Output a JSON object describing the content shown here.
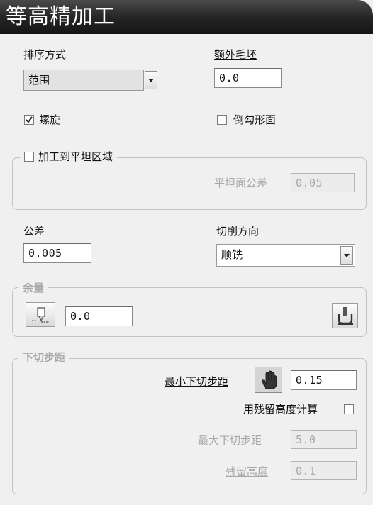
{
  "window": {
    "title": "等高精加工"
  },
  "order": {
    "label": "排序方式",
    "value": "范围"
  },
  "extra_stock": {
    "label": "额外毛坯",
    "value": "0.0"
  },
  "spiral": {
    "label": "螺旋",
    "checked": true
  },
  "undercut": {
    "label": "倒勾形面",
    "checked": false
  },
  "flats_group": {
    "label": "加工到平坦区域",
    "checked": false,
    "flat_tol_label": "平坦面公差",
    "flat_tol_value": "0.05"
  },
  "tolerance": {
    "label": "公差",
    "value": "0.005"
  },
  "cut_direction": {
    "label": "切削方向",
    "value": "顺铣"
  },
  "allowance_group": {
    "label": "余量",
    "value": "0.0"
  },
  "stepdown_group": {
    "label": "下切步距",
    "min_label": "最小下切步距",
    "min_value": "0.15",
    "use_cusp_label": "用残留高度计算",
    "use_cusp_checked": false,
    "max_label": "最大下切步距",
    "max_value": "5.0",
    "cusp_label": "残留高度",
    "cusp_value": "0.1"
  },
  "icons": {
    "allowance": "tool-allowance-icon",
    "component_allowance": "component-thickness-icon",
    "stepdown": "hand-icon"
  }
}
